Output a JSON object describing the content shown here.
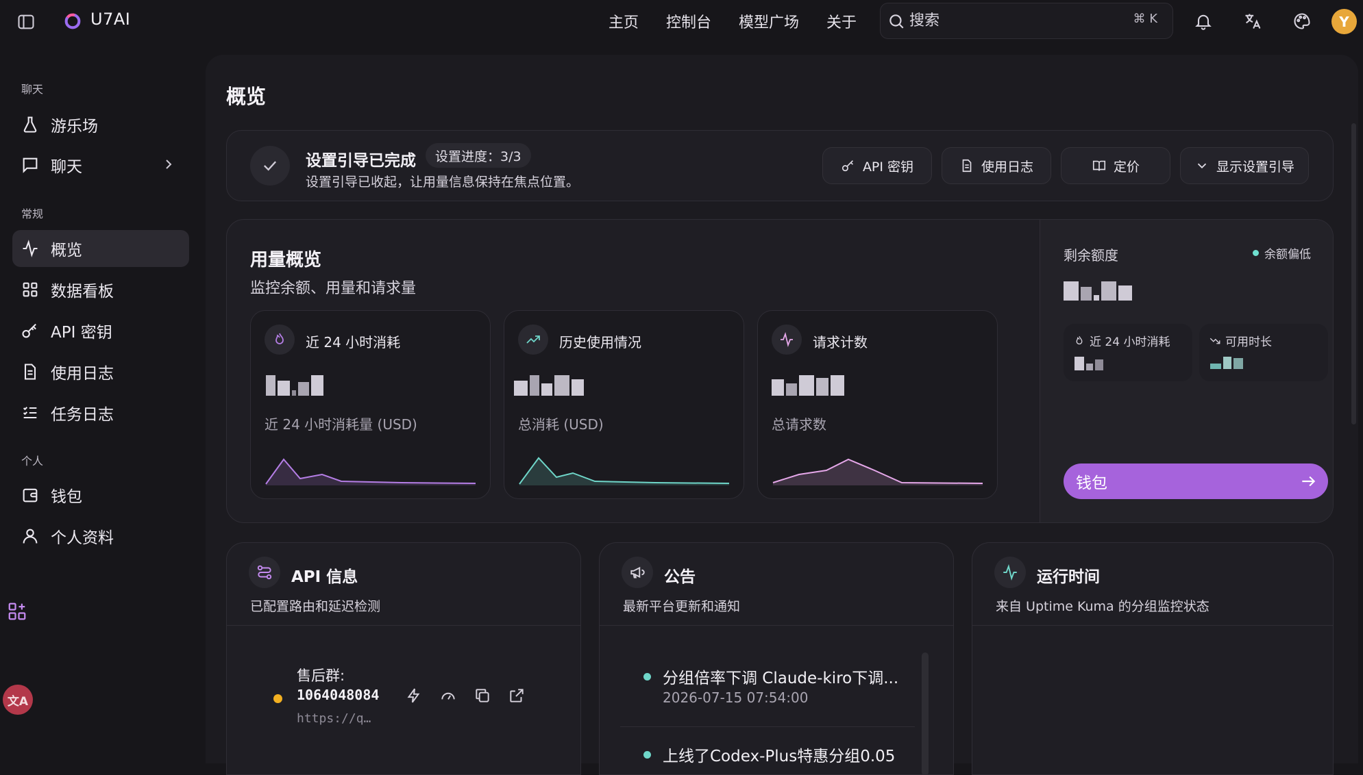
{
  "topbar": {
    "brand": "U7AI",
    "nav": [
      "主页",
      "控制台",
      "模型广场",
      "关于"
    ],
    "search_placeholder": "搜索",
    "search_shortcut": "⌘ K",
    "avatar_initial": "Y"
  },
  "sidebar": {
    "sections": [
      {
        "title": "聊天",
        "items": [
          {
            "label": "游乐场",
            "icon": "flask-icon"
          },
          {
            "label": "聊天",
            "icon": "chat-icon",
            "has_submenu": true
          }
        ]
      },
      {
        "title": "常规",
        "items": [
          {
            "label": "概览",
            "icon": "activity-icon",
            "active": true
          },
          {
            "label": "数据看板",
            "icon": "grid-icon"
          },
          {
            "label": "API 密钥",
            "icon": "key-icon"
          },
          {
            "label": "使用日志",
            "icon": "document-icon"
          },
          {
            "label": "任务日志",
            "icon": "list-icon"
          }
        ]
      },
      {
        "title": "个人",
        "items": [
          {
            "label": "钱包",
            "icon": "wallet-icon"
          },
          {
            "label": "个人资料",
            "icon": "user-icon"
          }
        ]
      }
    ]
  },
  "page": {
    "title": "概览"
  },
  "guide": {
    "title": "设置引导已完成",
    "progress": "设置进度：3/3",
    "description": "设置引导已收起，让用量信息保持在焦点位置。",
    "buttons": [
      "API 密钥",
      "使用日志",
      "定价",
      "显示设置引导"
    ]
  },
  "usage": {
    "title": "用量概览",
    "subtitle": "监控余额、用量和请求量",
    "cards": [
      {
        "title": "近 24 小时消耗",
        "label": "近 24 小时消耗量 (USD)",
        "color": "#b57ee6"
      },
      {
        "title": "历史使用情况",
        "label": "总消耗 (USD)",
        "color": "#6fd6c9"
      },
      {
        "title": "请求计数",
        "label": "总请求数",
        "color": "#e6a8ea"
      }
    ],
    "balance": {
      "title": "剩余额度",
      "badge": "余额偏低",
      "mini1": "近 24 小时消耗",
      "mini2": "可用时长",
      "wallet_button": "钱包"
    }
  },
  "panels": {
    "api": {
      "title": "API 信息",
      "subtitle": "已配置路由和延迟检测",
      "label": "售后群:",
      "number": "1064048084",
      "url": "https://q…"
    },
    "announce": {
      "title": "公告",
      "subtitle": "最新平台更新和通知",
      "items": [
        {
          "title": "分组倍率下调 Claude-kiro下调...",
          "date": "2026-07-15 07:54:00"
        },
        {
          "title": "上线了Codex-Plus特惠分组0.05",
          "date": ""
        }
      ]
    },
    "uptime": {
      "title": "运行时间",
      "subtitle": "来自 Uptime Kuma 的分组监控状态"
    }
  },
  "colors": {
    "accent": "#a663dc",
    "warning_dot": "#f3b021",
    "teal": "#6fd6c9"
  }
}
